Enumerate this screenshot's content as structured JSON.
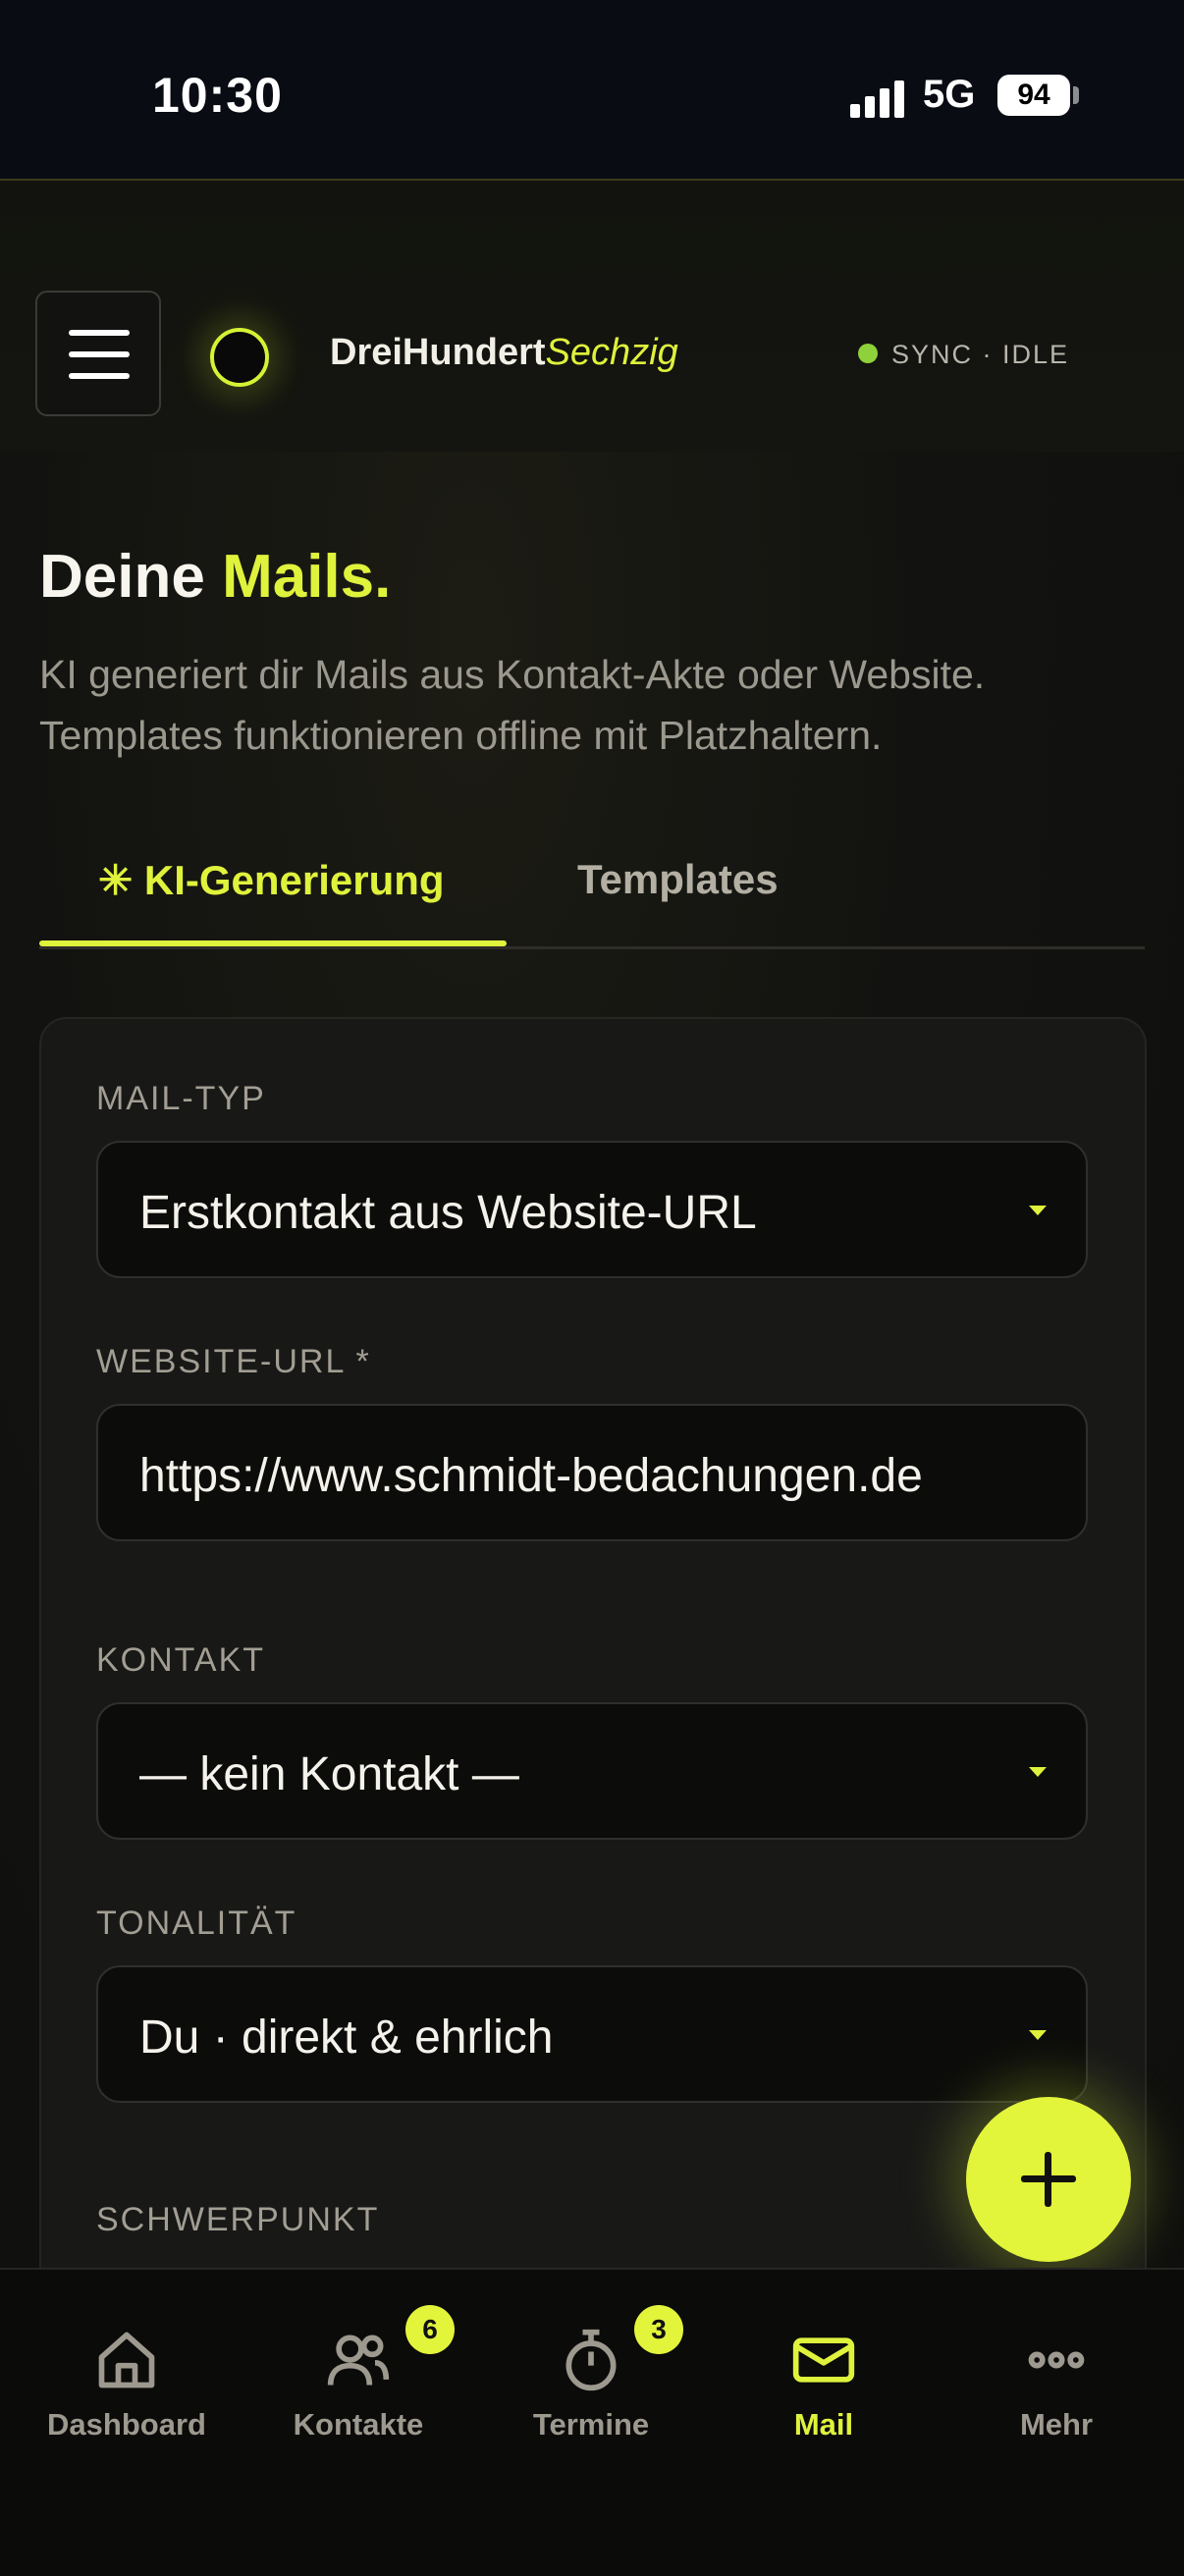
{
  "status_bar": {
    "time": "10:30",
    "network": "5G",
    "battery": "94"
  },
  "header": {
    "brand_main": "DreiHundert",
    "brand_accent": "Sechzig",
    "sync_status": "SYNC · IDLE"
  },
  "page": {
    "title_main": "Deine",
    "title_accent": "Mails.",
    "subtitle": "KI generiert dir Mails aus Kontakt-Akte oder Website. Templates funktionieren offline mit Platzhaltern."
  },
  "tabs": [
    {
      "label": "✳ KI-Generierung",
      "active": true
    },
    {
      "label": "Templates",
      "active": false
    }
  ],
  "form": {
    "mail_type": {
      "label": "MAIL-TYP",
      "value": "Erstkontakt aus Website-URL"
    },
    "website_url": {
      "label": "WEBSITE-URL *",
      "value": "https://www.schmidt-bedachungen.de"
    },
    "contact": {
      "label": "KONTAKT",
      "value": "— kein Kontakt —"
    },
    "tone": {
      "label": "TONALITÄT",
      "value": "Du · direkt & ehrlich"
    },
    "focus": {
      "label": "SCHWERPUNKT"
    }
  },
  "bottom_nav": [
    {
      "label": "Dashboard",
      "icon": "home-icon",
      "badge": ""
    },
    {
      "label": "Kontakte",
      "icon": "users-icon",
      "badge": "6"
    },
    {
      "label": "Termine",
      "icon": "stopwatch-icon",
      "badge": "3"
    },
    {
      "label": "Mail",
      "icon": "mail-icon",
      "badge": "",
      "active": true
    },
    {
      "label": "Mehr",
      "icon": "more-dots-icon",
      "badge": ""
    }
  ],
  "colors": {
    "accent": "#dff23c",
    "background": "#0d0d0c",
    "status_dot": "#8fd13a"
  }
}
